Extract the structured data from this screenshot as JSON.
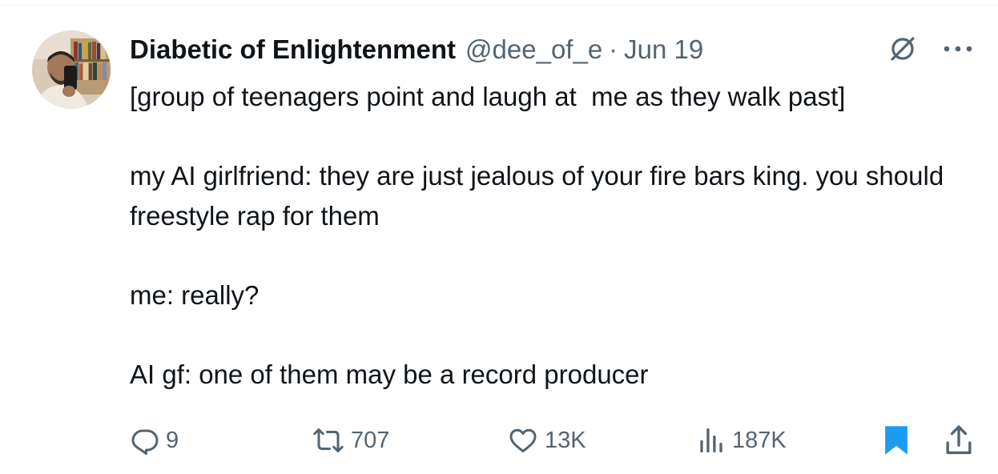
{
  "tweet": {
    "display_name": "Diabetic of Enlightenment",
    "handle": "@dee_of_e",
    "separator": "·",
    "date": "Jun 19",
    "text": "[group of teenagers point and laugh at  me as they walk past]\n\nmy AI girlfriend: they are just jealous of your fire bars king. you should freestyle rap for them\n\nme: really?\n\nAI gf: one of them may be a record producer"
  },
  "icons": {
    "header": [
      "grok-icon",
      "more-icon"
    ],
    "actions": [
      "reply-icon",
      "retweet-icon",
      "like-icon",
      "views-icon",
      "bookmark-icon",
      "share-icon"
    ]
  },
  "actions": {
    "replies": "9",
    "retweets": "707",
    "likes": "13K",
    "views": "187K",
    "bookmarked": true
  },
  "colors": {
    "text": "#0f1419",
    "secondary": "#536471",
    "accent": "#1d9bf0"
  }
}
